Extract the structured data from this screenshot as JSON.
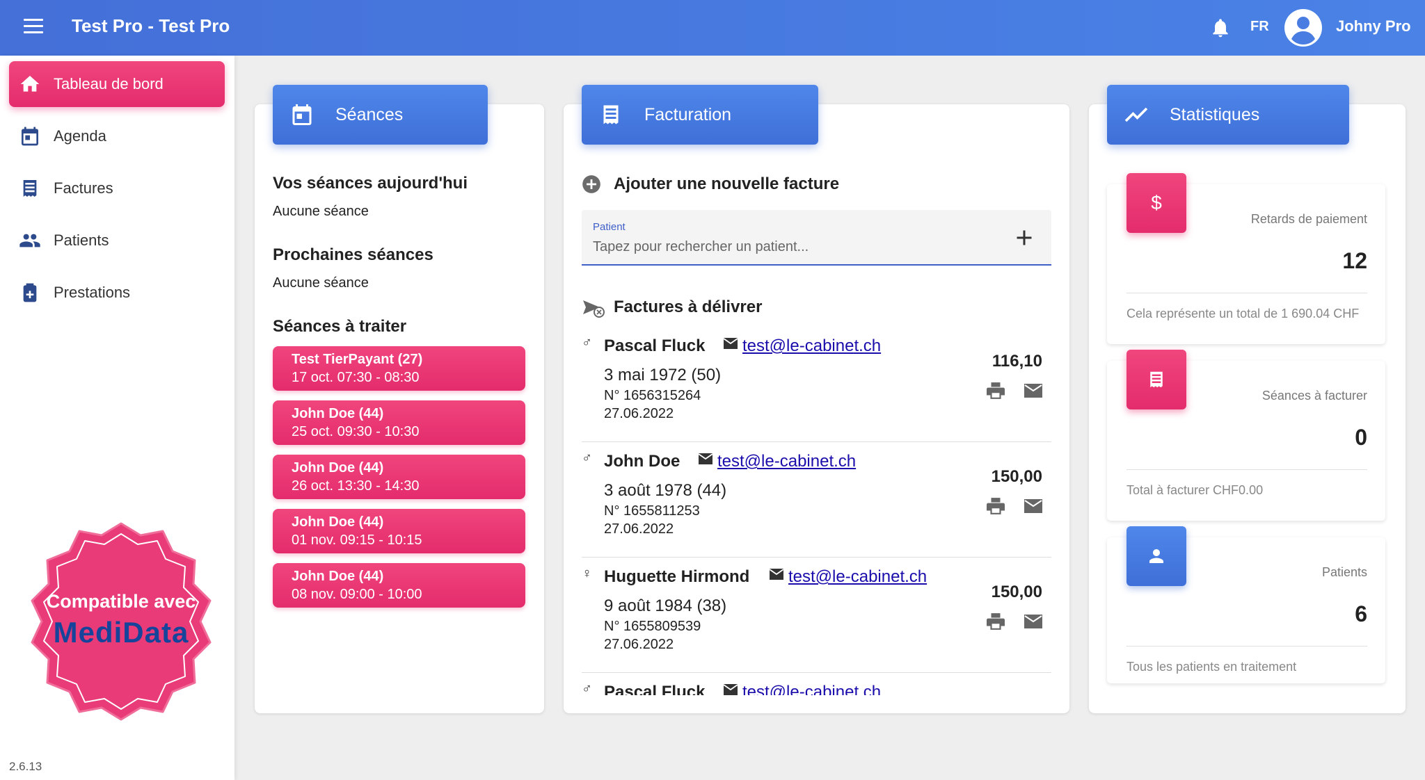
{
  "app": {
    "title": "Test Pro - Test Pro",
    "language": "FR",
    "user": "Johny Pro",
    "version": "2.6.13"
  },
  "sidebar": {
    "items": [
      {
        "label": "Tableau de bord",
        "icon": "home-icon",
        "active": true
      },
      {
        "label": "Agenda",
        "icon": "calendar-icon",
        "active": false
      },
      {
        "label": "Factures",
        "icon": "invoice-icon",
        "active": false
      },
      {
        "label": "Patients",
        "icon": "people-icon",
        "active": false
      },
      {
        "label": "Prestations",
        "icon": "medical-kit-icon",
        "active": false
      }
    ],
    "badge": {
      "line1": "Compatible avec",
      "line2": "MediData"
    }
  },
  "sessions": {
    "header": "Séances",
    "today_title": "Vos séances aujourd'hui",
    "today_text": "Aucune séance",
    "next_title": "Prochaines séances",
    "next_text": "Aucune séance",
    "todo_title": "Séances à traiter",
    "todo": [
      {
        "name": "Test TierPayant (27)",
        "time": "17 oct. 07:30 - 08:30"
      },
      {
        "name": "John Doe (44)",
        "time": "25 oct. 09:30 - 10:30"
      },
      {
        "name": "John Doe (44)",
        "time": "26 oct. 13:30 - 14:30"
      },
      {
        "name": "John Doe (44)",
        "time": "01 nov. 09:15 - 10:15"
      },
      {
        "name": "John Doe (44)",
        "time": "08 nov. 09:00 - 10:00"
      }
    ]
  },
  "billing": {
    "header": "Facturation",
    "add_title": "Ajouter une nouvelle facture",
    "patient_label": "Patient",
    "patient_placeholder": "Tapez pour rechercher un patient...",
    "deliver_title": "Factures à délivrer",
    "invoices": [
      {
        "gender": "♂",
        "name": "Pascal Fluck",
        "email": "test@le-cabinet.ch",
        "dob": "3 mai 1972 (50)",
        "number": "N° 1656315264",
        "date": "27.06.2022",
        "amount": "116,10"
      },
      {
        "gender": "♂",
        "name": "John Doe",
        "email": "test@le-cabinet.ch",
        "dob": "3 août 1978 (44)",
        "number": "N° 1655811253",
        "date": "27.06.2022",
        "amount": "150,00"
      },
      {
        "gender": "♀",
        "name": "Huguette Hirmond",
        "email": "test@le-cabinet.ch",
        "dob": "9 août 1984 (38)",
        "number": "N° 1655809539",
        "date": "27.06.2022",
        "amount": "150,00"
      },
      {
        "gender": "♂",
        "name": "Pascal Fluck",
        "email": "test@le-cabinet.ch",
        "dob": "",
        "number": "",
        "date": "",
        "amount": ""
      }
    ]
  },
  "stats": {
    "header": "Statistiques",
    "cards": [
      {
        "icon": "dollar-icon",
        "label": "Retards de paiement",
        "value": "12",
        "foot": "Cela représente un total de 1 690.04 CHF"
      },
      {
        "icon": "receipt-icon",
        "label": "Séances à facturer",
        "value": "0",
        "foot": "Total à facturer CHF0.00"
      },
      {
        "icon": "person-icon",
        "label": "Patients",
        "value": "6",
        "foot": "Tous les patients en traitement"
      }
    ]
  }
}
